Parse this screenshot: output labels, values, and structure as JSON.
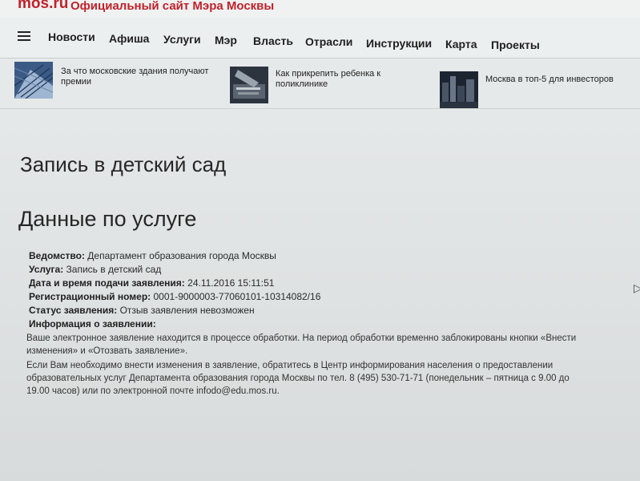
{
  "header": {
    "logo": "mos.ru",
    "site_title": "Официальный сайт Мэра Москвы"
  },
  "nav": {
    "items": [
      "Новости",
      "Афиша",
      "Услуги",
      "Мэр",
      "Власть",
      "Отрасли",
      "Инструкции",
      "Карта",
      "Проекты"
    ]
  },
  "news": [
    {
      "title": "За что московские здания получают премии"
    },
    {
      "title": "Как прикрепить ребенка к поликлинике"
    },
    {
      "title": "Москва в топ-5 для инвесторов"
    }
  ],
  "page": {
    "title": "Запись в детский сад",
    "section_title": "Данные по услуге"
  },
  "service": {
    "department_label": "Ведомство:",
    "department_value": "Департамент образования города Москвы",
    "service_label": "Услуга:",
    "service_value": "Запись в детский сад",
    "date_label": "Дата и время подачи заявления:",
    "date_value": "24.11.2016 15:11:51",
    "reg_label": "Регистрационный номер:",
    "reg_value": "0001-9000003-77060101-10314082/16",
    "status_label": "Статус заявления:",
    "status_value": "Отзыв заявления невозможен",
    "info_label": "Информация о заявлении:",
    "info_p1_line1": "Ваше электронное заявление находится в процессе обработки. На период обработки временно заблокированы кнопки «Внести",
    "info_p1_line2": "изменения» и «Отозвать заявление».",
    "info_p2_line1": "Если Вам необходимо внести изменения в заявление, обратитесь в Центр информирования населения о предоставлении",
    "info_p2_line2": "образовательных услуг Департамента образования города Москвы по тел. 8 (495) 530-71-71 (понедельник – пятница с 9.00 до",
    "info_p2_line3": "19.00 часов) или по электронной почте infodo@edu.mos.ru."
  },
  "colors": {
    "brand": "#c0222b",
    "text": "#1e1e1e",
    "background": "#e3e6e6"
  }
}
